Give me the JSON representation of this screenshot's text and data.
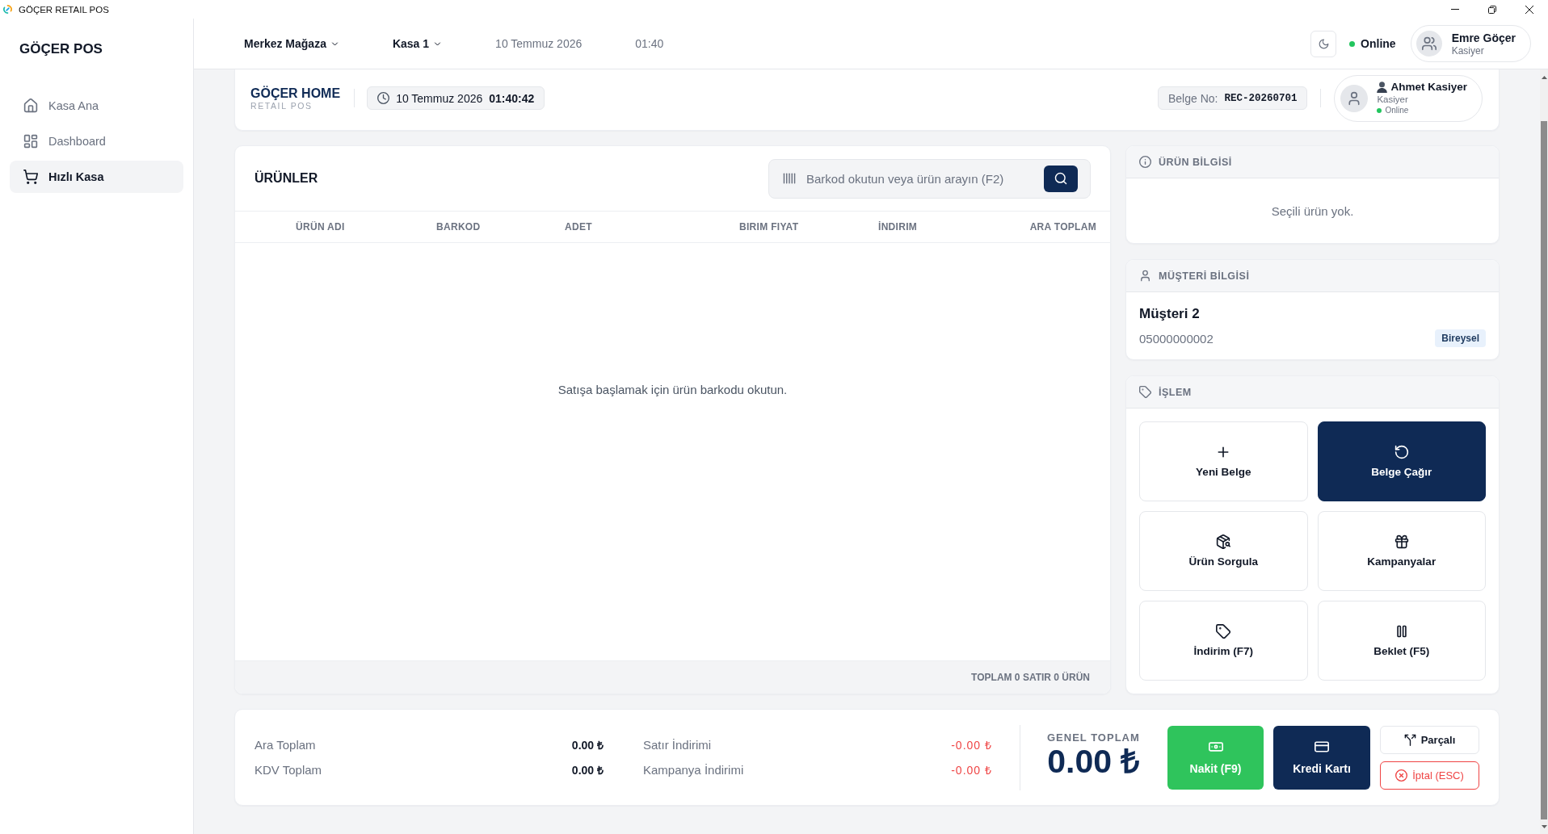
{
  "window": {
    "title": "GÖÇER RETAIL POS"
  },
  "sidebar": {
    "brand": "GÖÇER POS",
    "items": [
      {
        "label": "Kasa Ana",
        "selected": false
      },
      {
        "label": "Dashboard",
        "selected": false
      },
      {
        "label": "Hızlı Kasa",
        "selected": true
      }
    ]
  },
  "topbar": {
    "store": "Merkez Mağaza",
    "register": "Kasa 1",
    "date": "10 Temmuz 2026",
    "time": "01:40",
    "status": {
      "label": "Online",
      "online": true
    },
    "user": {
      "name": "Emre Göçer",
      "role": "Kasiyer"
    }
  },
  "receipt_header": {
    "store_name": "GÖÇER HOME",
    "subtitle": "RETAIL POS",
    "date": "10 Temmuz 2026",
    "time": "01:40:42",
    "document_label": "Belge No:",
    "document_number": "REC-20260701",
    "cashier": {
      "name": "Ahmet Kasiyer",
      "role": "Kasiyer",
      "status": "Online",
      "online": true
    }
  },
  "products": {
    "title": "ÜRÜNLER",
    "search": {
      "placeholder": "Barkod okutun veya ürün arayın (F2)"
    },
    "columns": [
      "ÜRÜN ADI",
      "BARKOD",
      "ADET",
      "BIRIM FIYAT",
      "İNDIRIM",
      "ARA TOPLAM"
    ],
    "empty_message": "Satışa başlamak için ürün barkodu okutun.",
    "footer": "TOPLAM 0 SATIR 0 ÜRÜN"
  },
  "product_info": {
    "title": "ÜRÜN BİLGİSİ",
    "empty_message": "Seçili ürün yok."
  },
  "customer": {
    "title": "MÜŞTERİ BİLGİSİ",
    "name": "Müşteri 2",
    "phone": "05000000002",
    "type_badge": "Bireysel"
  },
  "actions": {
    "title": "İŞLEM",
    "buttons": [
      {
        "label": "Yeni Belge",
        "kind": "outline"
      },
      {
        "label": "Belge Çağır",
        "kind": "primary"
      },
      {
        "label": "Ürün Sorgula",
        "kind": "outline"
      },
      {
        "label": "Kampanyalar",
        "kind": "outline"
      },
      {
        "label": "İndirim (F7)",
        "kind": "outline"
      },
      {
        "label": "Beklet (F5)",
        "kind": "outline"
      }
    ]
  },
  "totals": {
    "lines": [
      {
        "label": "Ara Toplam",
        "value": "0.00 ₺",
        "kind": "plain"
      },
      {
        "label": "KDV Toplam",
        "value": "0.00 ₺",
        "kind": "plain"
      },
      {
        "label": "Satır İndirimi",
        "value": "-0.00 ₺",
        "kind": "discount"
      },
      {
        "label": "Kampanya İndirimi",
        "value": "-0.00 ₺",
        "kind": "discount"
      }
    ],
    "grand_total": {
      "label": "GENEL TOPLAM",
      "value": "0.00 ₺"
    },
    "payment_buttons": [
      {
        "label": "Nakit (F9)",
        "kind": "success"
      },
      {
        "label": "Kredi Kartı",
        "kind": "primary"
      },
      {
        "label": "Parçalı",
        "kind": "outline"
      },
      {
        "label": "İptal (ESC)",
        "kind": "danger"
      }
    ]
  }
}
